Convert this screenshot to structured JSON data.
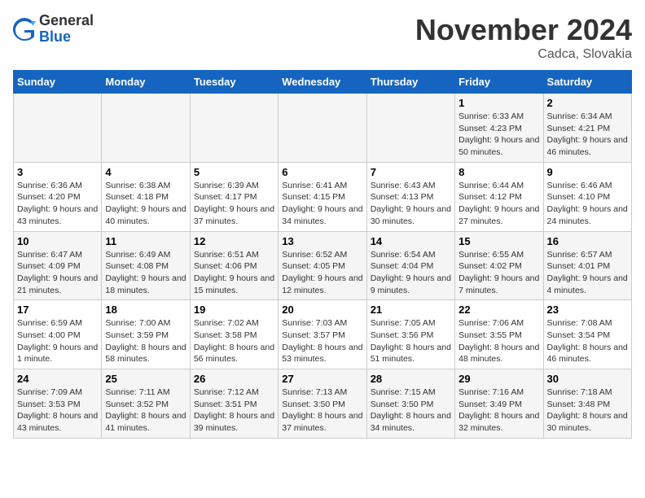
{
  "header": {
    "logo_general": "General",
    "logo_blue": "Blue",
    "month_title": "November 2024",
    "location": "Cadca, Slovakia"
  },
  "days_of_week": [
    "Sunday",
    "Monday",
    "Tuesday",
    "Wednesday",
    "Thursday",
    "Friday",
    "Saturday"
  ],
  "weeks": [
    [
      {
        "day": "",
        "info": ""
      },
      {
        "day": "",
        "info": ""
      },
      {
        "day": "",
        "info": ""
      },
      {
        "day": "",
        "info": ""
      },
      {
        "day": "",
        "info": ""
      },
      {
        "day": "1",
        "info": "Sunrise: 6:33 AM\nSunset: 4:23 PM\nDaylight: 9 hours and 50 minutes."
      },
      {
        "day": "2",
        "info": "Sunrise: 6:34 AM\nSunset: 4:21 PM\nDaylight: 9 hours and 46 minutes."
      }
    ],
    [
      {
        "day": "3",
        "info": "Sunrise: 6:36 AM\nSunset: 4:20 PM\nDaylight: 9 hours and 43 minutes."
      },
      {
        "day": "4",
        "info": "Sunrise: 6:38 AM\nSunset: 4:18 PM\nDaylight: 9 hours and 40 minutes."
      },
      {
        "day": "5",
        "info": "Sunrise: 6:39 AM\nSunset: 4:17 PM\nDaylight: 9 hours and 37 minutes."
      },
      {
        "day": "6",
        "info": "Sunrise: 6:41 AM\nSunset: 4:15 PM\nDaylight: 9 hours and 34 minutes."
      },
      {
        "day": "7",
        "info": "Sunrise: 6:43 AM\nSunset: 4:13 PM\nDaylight: 9 hours and 30 minutes."
      },
      {
        "day": "8",
        "info": "Sunrise: 6:44 AM\nSunset: 4:12 PM\nDaylight: 9 hours and 27 minutes."
      },
      {
        "day": "9",
        "info": "Sunrise: 6:46 AM\nSunset: 4:10 PM\nDaylight: 9 hours and 24 minutes."
      }
    ],
    [
      {
        "day": "10",
        "info": "Sunrise: 6:47 AM\nSunset: 4:09 PM\nDaylight: 9 hours and 21 minutes."
      },
      {
        "day": "11",
        "info": "Sunrise: 6:49 AM\nSunset: 4:08 PM\nDaylight: 9 hours and 18 minutes."
      },
      {
        "day": "12",
        "info": "Sunrise: 6:51 AM\nSunset: 4:06 PM\nDaylight: 9 hours and 15 minutes."
      },
      {
        "day": "13",
        "info": "Sunrise: 6:52 AM\nSunset: 4:05 PM\nDaylight: 9 hours and 12 minutes."
      },
      {
        "day": "14",
        "info": "Sunrise: 6:54 AM\nSunset: 4:04 PM\nDaylight: 9 hours and 9 minutes."
      },
      {
        "day": "15",
        "info": "Sunrise: 6:55 AM\nSunset: 4:02 PM\nDaylight: 9 hours and 7 minutes."
      },
      {
        "day": "16",
        "info": "Sunrise: 6:57 AM\nSunset: 4:01 PM\nDaylight: 9 hours and 4 minutes."
      }
    ],
    [
      {
        "day": "17",
        "info": "Sunrise: 6:59 AM\nSunset: 4:00 PM\nDaylight: 9 hours and 1 minute."
      },
      {
        "day": "18",
        "info": "Sunrise: 7:00 AM\nSunset: 3:59 PM\nDaylight: 8 hours and 58 minutes."
      },
      {
        "day": "19",
        "info": "Sunrise: 7:02 AM\nSunset: 3:58 PM\nDaylight: 8 hours and 56 minutes."
      },
      {
        "day": "20",
        "info": "Sunrise: 7:03 AM\nSunset: 3:57 PM\nDaylight: 8 hours and 53 minutes."
      },
      {
        "day": "21",
        "info": "Sunrise: 7:05 AM\nSunset: 3:56 PM\nDaylight: 8 hours and 51 minutes."
      },
      {
        "day": "22",
        "info": "Sunrise: 7:06 AM\nSunset: 3:55 PM\nDaylight: 8 hours and 48 minutes."
      },
      {
        "day": "23",
        "info": "Sunrise: 7:08 AM\nSunset: 3:54 PM\nDaylight: 8 hours and 46 minutes."
      }
    ],
    [
      {
        "day": "24",
        "info": "Sunrise: 7:09 AM\nSunset: 3:53 PM\nDaylight: 8 hours and 43 minutes."
      },
      {
        "day": "25",
        "info": "Sunrise: 7:11 AM\nSunset: 3:52 PM\nDaylight: 8 hours and 41 minutes."
      },
      {
        "day": "26",
        "info": "Sunrise: 7:12 AM\nSunset: 3:51 PM\nDaylight: 8 hours and 39 minutes."
      },
      {
        "day": "27",
        "info": "Sunrise: 7:13 AM\nSunset: 3:50 PM\nDaylight: 8 hours and 37 minutes."
      },
      {
        "day": "28",
        "info": "Sunrise: 7:15 AM\nSunset: 3:50 PM\nDaylight: 8 hours and 34 minutes."
      },
      {
        "day": "29",
        "info": "Sunrise: 7:16 AM\nSunset: 3:49 PM\nDaylight: 8 hours and 32 minutes."
      },
      {
        "day": "30",
        "info": "Sunrise: 7:18 AM\nSunset: 3:48 PM\nDaylight: 8 hours and 30 minutes."
      }
    ]
  ]
}
